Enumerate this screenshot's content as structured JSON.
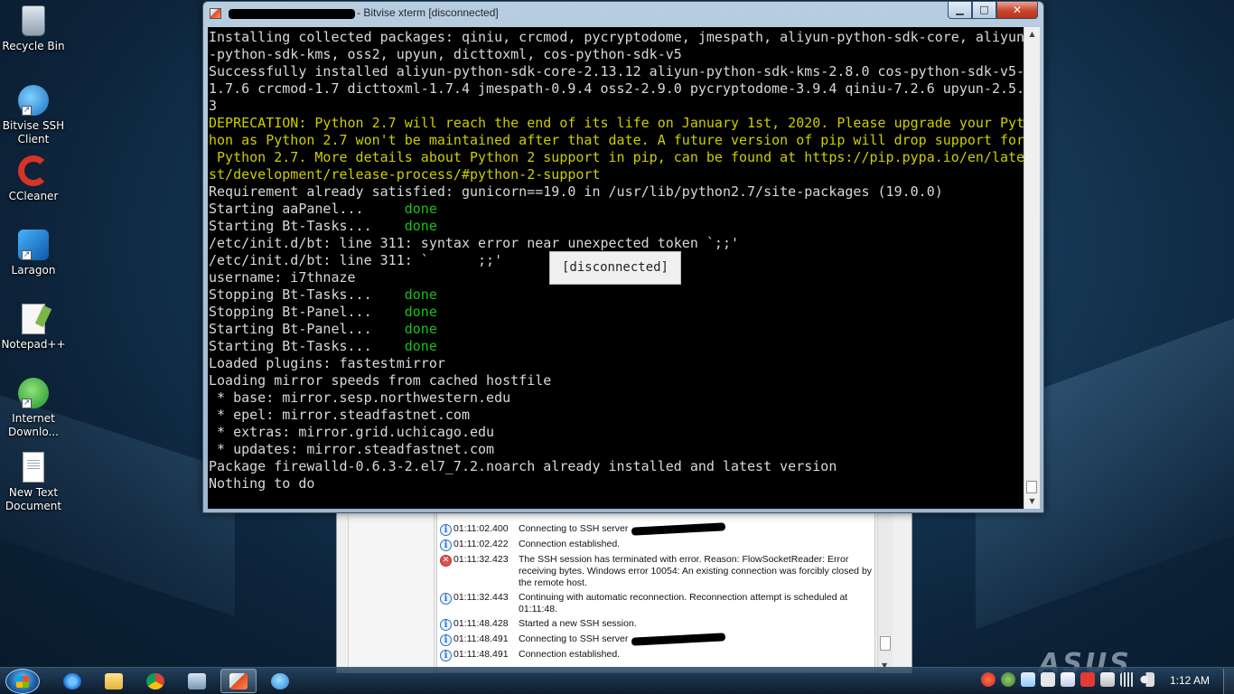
{
  "desktop": {
    "icons": [
      {
        "label": "Recycle Bin",
        "icon": "recycle-bin-icon"
      },
      {
        "label": "Bitvise SSH Client",
        "icon": "bitvise-ssh-client-icon"
      },
      {
        "label": "CCleaner",
        "icon": "ccleaner-icon"
      },
      {
        "label": "Laragon",
        "icon": "laragon-icon"
      },
      {
        "label": "Notepad++",
        "icon": "notepad-plus-plus-icon"
      },
      {
        "label": "Internet Downlo...",
        "icon": "internet-download-manager-icon"
      },
      {
        "label": "New Text Document",
        "icon": "text-document-icon"
      }
    ],
    "wallpaper_brand": "ASUS"
  },
  "xterm": {
    "title": "- Bitvise xterm [disconnected]",
    "overlay": "[disconnected]",
    "colors": {
      "background": "#000000",
      "text": "#d8d8d8",
      "warning": "#cdcd00",
      "done": "#1bbf1b"
    },
    "lines": [
      {
        "text": "Installing collected packages: qiniu, crcmod, pycryptodome, jmespath, aliyun-python-sdk-core, aliyun",
        "style": "normal"
      },
      {
        "text": "-python-sdk-kms, oss2, upyun, dicttoxml, cos-python-sdk-v5",
        "style": "normal"
      },
      {
        "text": "Successfully installed aliyun-python-sdk-core-2.13.12 aliyun-python-sdk-kms-2.8.0 cos-python-sdk-v5-",
        "style": "normal"
      },
      {
        "text": "1.7.6 crcmod-1.7 dicttoxml-1.7.4 jmespath-0.9.4 oss2-2.9.0 pycryptodome-3.9.4 qiniu-7.2.6 upyun-2.5.",
        "style": "normal"
      },
      {
        "text": "3",
        "style": "normal"
      },
      {
        "text": "DEPRECATION: Python 2.7 will reach the end of its life on January 1st, 2020. Please upgrade your Pyt",
        "style": "warn"
      },
      {
        "text": "hon as Python 2.7 won't be maintained after that date. A future version of pip will drop support for",
        "style": "warn"
      },
      {
        "text": " Python 2.7. More details about Python 2 support in pip, can be found at https://pip.pypa.io/en/late",
        "style": "warn"
      },
      {
        "text": "st/development/release-process/#python-2-support",
        "style": "warn"
      },
      {
        "text": "Requirement already satisfied: gunicorn==19.0 in /usr/lib/python2.7/site-packages (19.0.0)",
        "style": "normal"
      },
      {
        "text": "Starting aaPanel...     ",
        "status": "done",
        "style": "normal"
      },
      {
        "text": "Starting Bt-Tasks...    ",
        "status": "done",
        "style": "normal"
      },
      {
        "text": "/etc/init.d/bt: line 311: syntax error near unexpected token `;;'",
        "style": "normal"
      },
      {
        "text": "/etc/init.d/bt: line 311: `      ;;'",
        "style": "normal"
      },
      {
        "text": "username: i7thnaze",
        "style": "normal"
      },
      {
        "text": "Stopping Bt-Tasks...    ",
        "status": "done",
        "style": "normal"
      },
      {
        "text": "Stopping Bt-Panel...    ",
        "status": "done",
        "style": "normal"
      },
      {
        "text": "Starting Bt-Panel...    ",
        "status": "done",
        "style": "normal"
      },
      {
        "text": "Starting Bt-Tasks...    ",
        "status": "done",
        "style": "normal"
      },
      {
        "text": "Loaded plugins: fastestmirror",
        "style": "normal"
      },
      {
        "text": "Loading mirror speeds from cached hostfile",
        "style": "normal"
      },
      {
        "text": " * base: mirror.sesp.northwestern.edu",
        "style": "normal"
      },
      {
        "text": " * epel: mirror.steadfastnet.com",
        "style": "normal"
      },
      {
        "text": " * extras: mirror.grid.uchicago.edu",
        "style": "normal"
      },
      {
        "text": " * updates: mirror.steadfastnet.com",
        "style": "normal"
      },
      {
        "text": "Package firewalld-0.6.3-2.el7_7.2.noarch already installed and latest version",
        "style": "normal"
      },
      {
        "text": "Nothing to do",
        "style": "normal"
      }
    ]
  },
  "log_window": {
    "entries": [
      {
        "time": "01:11:02.400",
        "message": "Connecting to SSH server",
        "type": "info",
        "redacted": true
      },
      {
        "time": "01:11:02.422",
        "message": "Connection established.",
        "type": "info"
      },
      {
        "time": "01:11:32.423",
        "message": "The SSH session has terminated with error. Reason: FlowSocketReader: Error receiving bytes. Windows error 10054: An existing connection was forcibly closed by the remote host.",
        "type": "error"
      },
      {
        "time": "01:11:32.443",
        "message": "Continuing with automatic reconnection. Reconnection attempt is scheduled at 01:11:48.",
        "type": "info"
      },
      {
        "time": "01:11:48.428",
        "message": "Started a new SSH session.",
        "type": "info"
      },
      {
        "time": "01:11:48.491",
        "message": "Connecting to SSH server",
        "type": "info",
        "redacted": true
      },
      {
        "time": "01:11:48.491",
        "message": "Connection established.",
        "type": "info"
      }
    ]
  },
  "taskbar": {
    "pinned": [
      {
        "icon": "internet-explorer-icon"
      },
      {
        "icon": "file-explorer-icon"
      },
      {
        "icon": "chrome-icon"
      },
      {
        "icon": "network-app-icon"
      },
      {
        "icon": "bitvise-xterm-icon",
        "active": true
      },
      {
        "icon": "bitvise-ssh-client-icon"
      }
    ],
    "tray_icons": [
      "ccleaner-tray-icon",
      "network-tray-icon",
      "home-icon",
      "flag-icon",
      "usb-icon",
      "cpu-icon",
      "signal-icon",
      "volume-icon"
    ],
    "clock": "1:12 AM"
  }
}
